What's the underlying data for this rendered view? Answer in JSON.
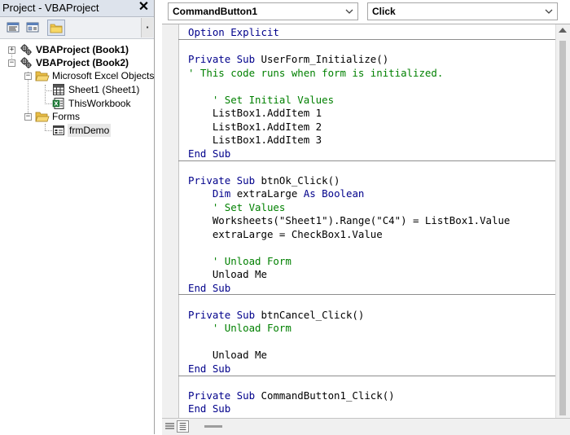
{
  "project_explorer": {
    "title": "Project - VBAProject",
    "close_glyph": "✕",
    "toolbar": {
      "buttons": [
        {
          "name": "view-code",
          "icon": "view-code-icon",
          "active": false
        },
        {
          "name": "view-object",
          "icon": "view-object-icon",
          "active": false
        },
        {
          "name": "toggle-folders",
          "icon": "folder-icon",
          "active": true
        }
      ]
    },
    "tree": {
      "book1": {
        "label": "VBAProject (Book1)",
        "expander": "+"
      },
      "book2": {
        "label": "VBAProject (Book2)",
        "expander": "−"
      },
      "excel_objects": {
        "label": "Microsoft Excel Objects",
        "expander": "−"
      },
      "sheet1": {
        "label": "Sheet1 (Sheet1)"
      },
      "this_workbook": {
        "label": "ThisWorkbook"
      },
      "forms": {
        "label": "Forms",
        "expander": "−"
      },
      "frm_demo": {
        "label": "frmDemo"
      }
    }
  },
  "code_window": {
    "object_combo": {
      "value": "CommandButton1"
    },
    "procedure_combo": {
      "value": "Click"
    }
  },
  "code": {
    "l01": [
      {
        "t": "Option Explicit",
        "c": "kw"
      }
    ],
    "l02": [],
    "l03": [
      {
        "t": "Private Sub",
        "c": "kw"
      },
      {
        "t": " UserForm_Initialize()",
        "c": ""
      }
    ],
    "l04": [
      {
        "t": "' This code runs when form is initialized.",
        "c": "cm"
      }
    ],
    "l05": [],
    "l06": [
      {
        "t": "    ' Set Initial Values",
        "c": "cm"
      }
    ],
    "l07": [
      {
        "t": "    ListBox1.AddItem 1",
        "c": ""
      }
    ],
    "l08": [
      {
        "t": "    ListBox1.AddItem 2",
        "c": ""
      }
    ],
    "l09": [
      {
        "t": "    ListBox1.AddItem 3",
        "c": ""
      }
    ],
    "l10": [
      {
        "t": "End Sub",
        "c": "kw"
      }
    ],
    "l11": [],
    "l12": [
      {
        "t": "Private Sub",
        "c": "kw"
      },
      {
        "t": " btnOk_Click()",
        "c": ""
      }
    ],
    "l13": [
      {
        "t": "    ",
        "c": ""
      },
      {
        "t": "Dim",
        "c": "kw"
      },
      {
        "t": " extraLarge ",
        "c": ""
      },
      {
        "t": "As Boolean",
        "c": "kw"
      }
    ],
    "l14": [
      {
        "t": "    ' Set Values",
        "c": "cm"
      }
    ],
    "l15": [
      {
        "t": "    Worksheets(\"Sheet1\").Range(\"C4\") = ListBox1.Value",
        "c": ""
      }
    ],
    "l16": [
      {
        "t": "    extraLarge = CheckBox1.Value",
        "c": ""
      }
    ],
    "l17": [],
    "l18": [
      {
        "t": "    ' Unload Form",
        "c": "cm"
      }
    ],
    "l19": [
      {
        "t": "    Unload Me",
        "c": ""
      }
    ],
    "l20": [
      {
        "t": "End Sub",
        "c": "kw"
      }
    ],
    "l21": [],
    "l22": [
      {
        "t": "Private Sub",
        "c": "kw"
      },
      {
        "t": " btnCancel_Click()",
        "c": ""
      }
    ],
    "l23": [
      {
        "t": "    ' Unload Form",
        "c": "cm"
      }
    ],
    "l24": [],
    "l25": [
      {
        "t": "    Unload Me",
        "c": ""
      }
    ],
    "l26": [
      {
        "t": "End Sub",
        "c": "kw"
      }
    ],
    "l27": [],
    "l28": [
      {
        "t": "Private Sub",
        "c": "kw"
      },
      {
        "t": " CommandButton1_Click()",
        "c": ""
      }
    ],
    "l29": [
      {
        "t": "End Sub",
        "c": "kw"
      }
    ]
  },
  "colors": {
    "keyword": "#00008b",
    "comment": "#008000",
    "text": "#000000"
  }
}
